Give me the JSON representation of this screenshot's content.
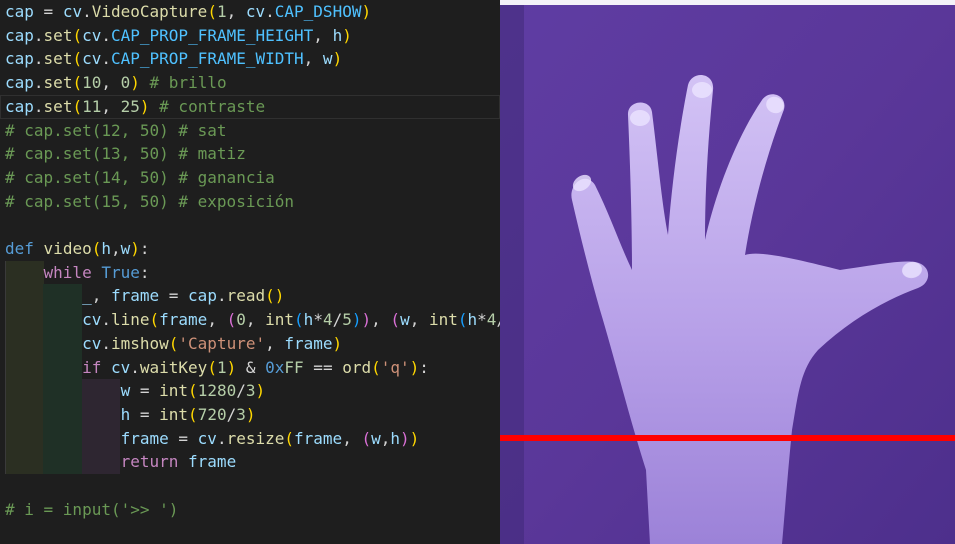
{
  "code_lines": [
    [
      {
        "t": "cap",
        "c": "var"
      },
      {
        "t": " = ",
        "c": "op"
      },
      {
        "t": "cv",
        "c": "var"
      },
      {
        "t": ".",
        "c": "op"
      },
      {
        "t": "VideoCapture",
        "c": "fn"
      },
      {
        "t": "(",
        "c": "b1"
      },
      {
        "t": "1",
        "c": "num"
      },
      {
        "t": ", ",
        "c": "op"
      },
      {
        "t": "cv",
        "c": "var"
      },
      {
        "t": ".",
        "c": "op"
      },
      {
        "t": "CAP_DSHOW",
        "c": "const"
      },
      {
        "t": ")",
        "c": "b1"
      }
    ],
    [
      {
        "t": "cap",
        "c": "var"
      },
      {
        "t": ".",
        "c": "op"
      },
      {
        "t": "set",
        "c": "fn"
      },
      {
        "t": "(",
        "c": "b1"
      },
      {
        "t": "cv",
        "c": "var"
      },
      {
        "t": ".",
        "c": "op"
      },
      {
        "t": "CAP_PROP_FRAME_HEIGHT",
        "c": "const"
      },
      {
        "t": ", ",
        "c": "op"
      },
      {
        "t": "h",
        "c": "var"
      },
      {
        "t": ")",
        "c": "b1"
      }
    ],
    [
      {
        "t": "cap",
        "c": "var"
      },
      {
        "t": ".",
        "c": "op"
      },
      {
        "t": "set",
        "c": "fn"
      },
      {
        "t": "(",
        "c": "b1"
      },
      {
        "t": "cv",
        "c": "var"
      },
      {
        "t": ".",
        "c": "op"
      },
      {
        "t": "CAP_PROP_FRAME_WIDTH",
        "c": "const"
      },
      {
        "t": ", ",
        "c": "op"
      },
      {
        "t": "w",
        "c": "var"
      },
      {
        "t": ")",
        "c": "b1"
      }
    ],
    [
      {
        "t": "cap",
        "c": "var"
      },
      {
        "t": ".",
        "c": "op"
      },
      {
        "t": "set",
        "c": "fn"
      },
      {
        "t": "(",
        "c": "b1"
      },
      {
        "t": "10",
        "c": "num"
      },
      {
        "t": ", ",
        "c": "op"
      },
      {
        "t": "0",
        "c": "num"
      },
      {
        "t": ")",
        "c": "b1"
      },
      {
        "t": " # brillo",
        "c": "cmt"
      }
    ],
    [
      {
        "t": "cap",
        "c": "var"
      },
      {
        "t": ".",
        "c": "op"
      },
      {
        "t": "set",
        "c": "fn"
      },
      {
        "t": "(",
        "c": "b1"
      },
      {
        "t": "11",
        "c": "num"
      },
      {
        "t": ", ",
        "c": "op"
      },
      {
        "t": "25",
        "c": "num"
      },
      {
        "t": ")",
        "c": "b1"
      },
      {
        "t": " # contraste",
        "c": "cmt"
      }
    ],
    [
      {
        "t": "# cap.set(12, 50) # sat",
        "c": "cmt"
      }
    ],
    [
      {
        "t": "# cap.set(13, 50) # matiz",
        "c": "cmt"
      }
    ],
    [
      {
        "t": "# cap.set(14, 50) # ganancia",
        "c": "cmt"
      }
    ],
    [
      {
        "t": "# cap.set(15, 50) # exposición",
        "c": "cmt"
      }
    ],
    [],
    [
      {
        "t": "def",
        "c": "kw"
      },
      {
        "t": " ",
        "c": "op"
      },
      {
        "t": "video",
        "c": "fn"
      },
      {
        "t": "(",
        "c": "b1"
      },
      {
        "t": "h",
        "c": "var"
      },
      {
        "t": ",",
        "c": "op"
      },
      {
        "t": "w",
        "c": "var"
      },
      {
        "t": ")",
        "c": "b1"
      },
      {
        "t": ":",
        "c": "op"
      }
    ],
    [
      {
        "t": "    ",
        "c": "op"
      },
      {
        "t": "while",
        "c": "ctl"
      },
      {
        "t": " ",
        "c": "op"
      },
      {
        "t": "True",
        "c": "kw"
      },
      {
        "t": ":",
        "c": "op"
      }
    ],
    [
      {
        "t": "        ",
        "c": "op"
      },
      {
        "t": "_",
        "c": "var"
      },
      {
        "t": ", ",
        "c": "op"
      },
      {
        "t": "frame",
        "c": "var"
      },
      {
        "t": " = ",
        "c": "op"
      },
      {
        "t": "cap",
        "c": "var"
      },
      {
        "t": ".",
        "c": "op"
      },
      {
        "t": "read",
        "c": "fn"
      },
      {
        "t": "()",
        "c": "b1"
      }
    ],
    [
      {
        "t": "        ",
        "c": "op"
      },
      {
        "t": "cv",
        "c": "var"
      },
      {
        "t": ".",
        "c": "op"
      },
      {
        "t": "line",
        "c": "fn"
      },
      {
        "t": "(",
        "c": "b1"
      },
      {
        "t": "frame",
        "c": "var"
      },
      {
        "t": ", ",
        "c": "op"
      },
      {
        "t": "(",
        "c": "b2"
      },
      {
        "t": "0",
        "c": "num"
      },
      {
        "t": ", ",
        "c": "op"
      },
      {
        "t": "int",
        "c": "fn"
      },
      {
        "t": "(",
        "c": "b3"
      },
      {
        "t": "h",
        "c": "var"
      },
      {
        "t": "*",
        "c": "op"
      },
      {
        "t": "4",
        "c": "num"
      },
      {
        "t": "/",
        "c": "op"
      },
      {
        "t": "5",
        "c": "num"
      },
      {
        "t": ")",
        "c": "b3"
      },
      {
        "t": ")",
        "c": "b2"
      },
      {
        "t": ", ",
        "c": "op"
      },
      {
        "t": "(",
        "c": "b2"
      },
      {
        "t": "w",
        "c": "var"
      },
      {
        "t": ", ",
        "c": "op"
      },
      {
        "t": "int",
        "c": "fn"
      },
      {
        "t": "(",
        "c": "b3"
      },
      {
        "t": "h",
        "c": "var"
      },
      {
        "t": "*",
        "c": "op"
      },
      {
        "t": "4",
        "c": "num"
      },
      {
        "t": "/",
        "c": "op"
      }
    ],
    [
      {
        "t": "        ",
        "c": "op"
      },
      {
        "t": "cv",
        "c": "var"
      },
      {
        "t": ".",
        "c": "op"
      },
      {
        "t": "imshow",
        "c": "fn"
      },
      {
        "t": "(",
        "c": "b1"
      },
      {
        "t": "'Capture'",
        "c": "str"
      },
      {
        "t": ", ",
        "c": "op"
      },
      {
        "t": "frame",
        "c": "var"
      },
      {
        "t": ")",
        "c": "b1"
      }
    ],
    [
      {
        "t": "        ",
        "c": "op"
      },
      {
        "t": "if",
        "c": "ctl"
      },
      {
        "t": " ",
        "c": "op"
      },
      {
        "t": "cv",
        "c": "var"
      },
      {
        "t": ".",
        "c": "op"
      },
      {
        "t": "waitKey",
        "c": "fn"
      },
      {
        "t": "(",
        "c": "b1"
      },
      {
        "t": "1",
        "c": "num"
      },
      {
        "t": ")",
        "c": "b1"
      },
      {
        "t": " & ",
        "c": "op"
      },
      {
        "t": "0x",
        "c": "kw"
      },
      {
        "t": "FF",
        "c": "num"
      },
      {
        "t": " == ",
        "c": "op"
      },
      {
        "t": "ord",
        "c": "fn"
      },
      {
        "t": "(",
        "c": "b1"
      },
      {
        "t": "'q'",
        "c": "str"
      },
      {
        "t": ")",
        "c": "b1"
      },
      {
        "t": ":",
        "c": "op"
      }
    ],
    [
      {
        "t": "            ",
        "c": "op"
      },
      {
        "t": "w",
        "c": "var"
      },
      {
        "t": " = ",
        "c": "op"
      },
      {
        "t": "int",
        "c": "fn"
      },
      {
        "t": "(",
        "c": "b1"
      },
      {
        "t": "1280",
        "c": "num"
      },
      {
        "t": "/",
        "c": "op"
      },
      {
        "t": "3",
        "c": "num"
      },
      {
        "t": ")",
        "c": "b1"
      }
    ],
    [
      {
        "t": "            ",
        "c": "op"
      },
      {
        "t": "h",
        "c": "var"
      },
      {
        "t": " = ",
        "c": "op"
      },
      {
        "t": "int",
        "c": "fn"
      },
      {
        "t": "(",
        "c": "b1"
      },
      {
        "t": "720",
        "c": "num"
      },
      {
        "t": "/",
        "c": "op"
      },
      {
        "t": "3",
        "c": "num"
      },
      {
        "t": ")",
        "c": "b1"
      }
    ],
    [
      {
        "t": "            ",
        "c": "op"
      },
      {
        "t": "frame",
        "c": "var"
      },
      {
        "t": " = ",
        "c": "op"
      },
      {
        "t": "cv",
        "c": "var"
      },
      {
        "t": ".",
        "c": "op"
      },
      {
        "t": "resize",
        "c": "fn"
      },
      {
        "t": "(",
        "c": "b1"
      },
      {
        "t": "frame",
        "c": "var"
      },
      {
        "t": ", ",
        "c": "op"
      },
      {
        "t": "(",
        "c": "b2"
      },
      {
        "t": "w",
        "c": "var"
      },
      {
        "t": ",",
        "c": "op"
      },
      {
        "t": "h",
        "c": "var"
      },
      {
        "t": ")",
        "c": "b2"
      },
      {
        "t": ")",
        "c": "b1"
      }
    ],
    [
      {
        "t": "            ",
        "c": "op"
      },
      {
        "t": "return",
        "c": "ctl"
      },
      {
        "t": " ",
        "c": "op"
      },
      {
        "t": "frame",
        "c": "var"
      }
    ],
    [],
    [
      {
        "t": "# i = input('>> ')",
        "c": "cmt"
      }
    ]
  ],
  "indent_levels": [
    0,
    0,
    0,
    0,
    0,
    0,
    0,
    0,
    0,
    0,
    0,
    1,
    2,
    2,
    2,
    2,
    3,
    3,
    3,
    3,
    0,
    0
  ],
  "current_line_index": 4,
  "camera_view": {
    "subject": "hand",
    "overlay_line_color": "#ff0000",
    "background_color": "#5b3a9e",
    "skin_color": "#c6b2ef"
  }
}
